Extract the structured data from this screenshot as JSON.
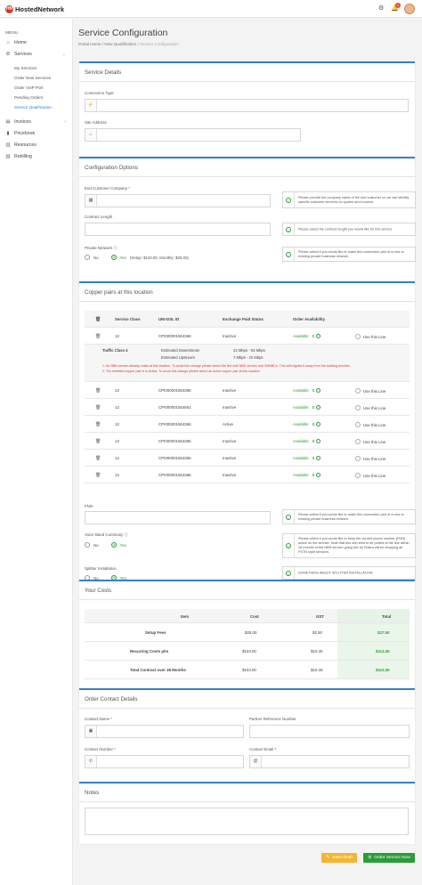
{
  "brand": {
    "name": "HostedNetwork",
    "mark": "HN",
    "accent": "#3a7fc4",
    "green": "#2c9b3a",
    "red": "#d9342b"
  },
  "header": {
    "notification_count": "1"
  },
  "sidebar": {
    "heading": "MENU",
    "items": [
      {
        "label": "Home",
        "icon": "home-icon"
      },
      {
        "label": "Services",
        "icon": "gear-icon"
      },
      {
        "label": "Invoices",
        "icon": "invoice-icon"
      },
      {
        "label": "Pricebook",
        "icon": "book-icon"
      },
      {
        "label": "Resources",
        "icon": "resources-icon"
      },
      {
        "label": "Rebilling",
        "icon": "rebilling-icon"
      }
    ],
    "services_sub": [
      "My Services",
      "Order New Services",
      "Order VoIP Port",
      "Pending Orders",
      "Service Qualification"
    ]
  },
  "page": {
    "title": "Service Configuration",
    "breadcrumb": [
      "Portal Home",
      "New Qualification",
      "Service Configuration"
    ]
  },
  "service_details": {
    "title": "Service Details",
    "connection_type_label": "Connection Type",
    "site_address_label": "Site Address"
  },
  "configuration": {
    "title": "Configuration Options",
    "end_customer_label": "End Customer Company *",
    "end_customer_hint": "Please provide the company name of the end customer so we can identify specific customer services on quotes and invoices.",
    "contract_length_label": "Contract Length",
    "contract_length_hint": "Please select the contract length you would like for this service.",
    "private_network_label": "Private Network",
    "no_label": "No",
    "yes_label": "Yes",
    "private_yes_detail": "(Setup: $110.00, Monthly: $25.00)",
    "private_network_hint": "Please select if you would like to make this connection part of a new or existing private business network."
  },
  "copper": {
    "title": "Copper pairs at this location",
    "headers": [
      "Service Class",
      "UNI-DSL ID",
      "Exchange Paid Status",
      "Order Availability"
    ],
    "available_label": "Available",
    "available_price": "$",
    "use_line_label": "Use this Line",
    "rows": [
      {
        "cls": "12",
        "id": "CPI000001554366",
        "status": "Inactive"
      },
      {
        "cls": "12",
        "id": "CPI000001554366",
        "status": "Inactive"
      },
      {
        "cls": "12",
        "id": "CPI000001554661",
        "status": "Inactive"
      },
      {
        "cls": "12",
        "id": "CPI000001554366",
        "status": "Active"
      },
      {
        "cls": "12",
        "id": "CPI000001554366",
        "status": "Inactive"
      },
      {
        "cls": "12",
        "id": "CPI000001554366",
        "status": "Inactive"
      },
      {
        "cls": "12",
        "id": "CPI000001554366",
        "status": "Inactive"
      }
    ],
    "detail": {
      "traffic_class": "Traffic Class 4",
      "down_label": "Estimated Downstream",
      "down_value": "22 Mbps - 53 Mbps",
      "up_label": "Estimated Upstream",
      "up_value": "7 Mbps - 22 Mbps",
      "warn1": "1. An NBN service already exists at this location. To avoid this change please select the line with NBD service and CMNBCs. This will migrate it away from the existing provider.",
      "warn2": "2. The selected copper pair is in Active. To avoid this change please select an active copper pair at this location."
    },
    "fnn_label": "FNN",
    "fnn_hint": "Please select if you would like to make this connection part of a new or existing private business network.",
    "vbc_label": "Voice Band Continuity",
    "vbc_hint": "Please select if you would like to keep the current phone number (FNN) active on the service. Note that this will need to be ported of the line within 18 months of the NBN service going live as Telstra will be dropping all PSTN style services.",
    "splitter_label": "Splitter Installation",
    "splitter_hint": "SOMETHING ABOUT SPLITTER INSTALLATION"
  },
  "costs": {
    "title": "Your Costs",
    "headers": [
      "Item",
      "Cost",
      "GST",
      "Total"
    ],
    "rows": [
      {
        "item": "Setup Fees",
        "cost": "$25.00",
        "gst": "$2.50",
        "total": "$27.50"
      },
      {
        "item": "Recurring Costs p/m",
        "cost": "$103.00",
        "gst": "$10.30",
        "total": "$113.30"
      },
      {
        "item": "Total Contract over 36 Months",
        "cost": "$103.00",
        "gst": "$10.30",
        "total": "$113.30"
      }
    ]
  },
  "contact": {
    "title": "Order Contact Details",
    "name_label": "Contact Name *",
    "ref_label": "Partner Reference Number",
    "number_label": "Contact Number *",
    "email_label": "Contact Email *"
  },
  "notes": {
    "title": "Notes"
  },
  "actions": {
    "save_label": "Save Draft",
    "order_label": "Order Service Now"
  }
}
